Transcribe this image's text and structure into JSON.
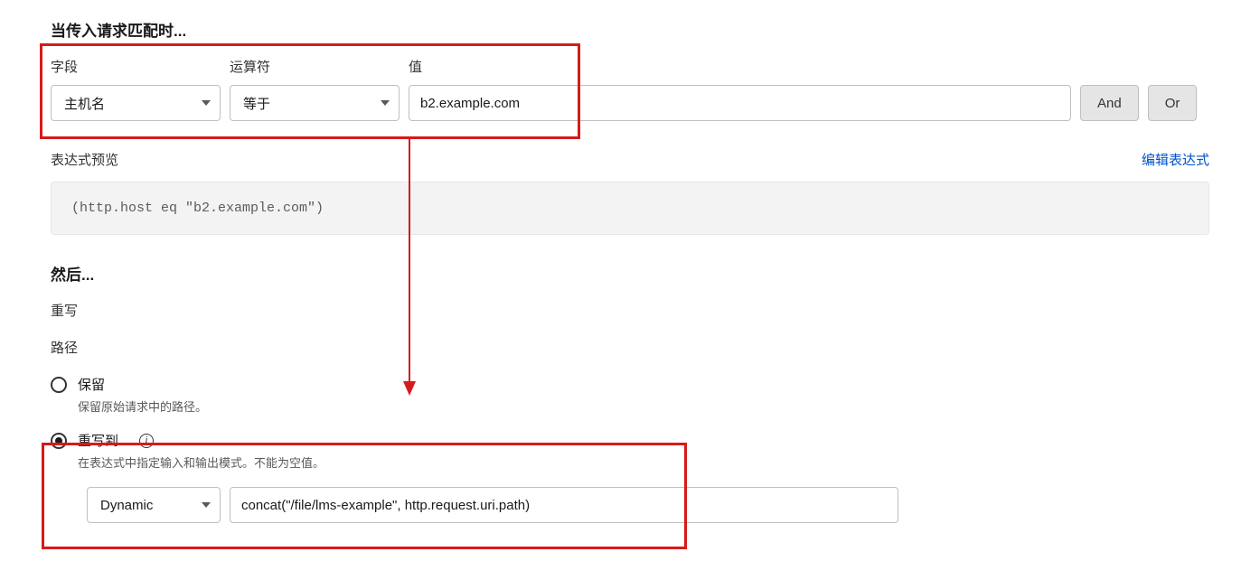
{
  "match": {
    "heading": "当传入请求匹配时...",
    "field_label": "字段",
    "operator_label": "运算符",
    "value_label": "值",
    "field_value": "主机名",
    "operator_value": "等于",
    "value": "b2.example.com",
    "and_label": "And",
    "or_label": "Or"
  },
  "preview": {
    "title": "表达式预览",
    "edit_link": "编辑表达式",
    "expression": "(http.host eq \"b2.example.com\")"
  },
  "then": {
    "heading": "然后...",
    "rewrite_label": "重写",
    "path_label": "路径",
    "option_preserve": {
      "label": "保留",
      "help": "保留原始请求中的路径。"
    },
    "option_rewrite": {
      "label": "重写到…",
      "help": "在表达式中指定输入和输出模式。不能为空值。"
    },
    "rewrite_type": "Dynamic",
    "rewrite_expr": "concat(\"/file/lms-example\", http.request.uri.path)"
  }
}
